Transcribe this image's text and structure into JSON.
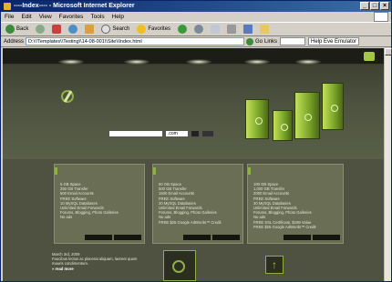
{
  "window": {
    "title": "----Index---- - Microsoft Internet Explorer",
    "minimize": "_",
    "maximize": "□",
    "close": "×"
  },
  "menu": [
    "File",
    "Edit",
    "View",
    "Favorites",
    "Tools",
    "Help"
  ],
  "toolbar": {
    "back": "Back",
    "search": "Search",
    "favorites": "Favorites"
  },
  "address": {
    "label": "Address",
    "value": "D:\\\\!Templates\\\\Testing\\\\14-08-001\\\\Site\\\\Index.html",
    "go": "Go",
    "links_label": "Links",
    "link1": "",
    "link2": "Help Eve Emulator"
  },
  "search": {
    "select_value": ".com"
  },
  "panels": [
    {
      "lines": [
        "5 GB Space",
        "250 GB Transfer",
        "500 Email Accounts",
        "FREE Software",
        "10 MySQL Databases",
        "Unlimited Email Forwards",
        "Forums, Blogging, Photo Galleries",
        "No ads"
      ]
    },
    {
      "lines": [
        "50 GB Space",
        "500 GB Transfer",
        "1500 Email Accounts",
        "FREE Software",
        "20 MySQL Databases",
        "Unlimited Email Forwards",
        "Forums, Blogging, Photo Galleries",
        "No ads",
        "FREE $25 Google AdWords™ Credit"
      ]
    },
    {
      "lines": [
        "100 GB Space",
        "1,000 GB Transfer",
        "2000 Email Accounts",
        "FREE Software",
        "30 MySQL Databases",
        "Unlimited Email Forwards",
        "Forums, Blogging, Photo Galleries",
        "No ads",
        "FREE SSL Certificate, $199 Value",
        "FREE $25 Google AdWords™ Credit"
      ]
    }
  ],
  "news": {
    "date": "March 3rd, 2009",
    "body": "Faucibus lectus ac placerat aliquam, laoreet quam mauris condimentum.",
    "more": "» read more"
  },
  "colors": {
    "accent": "#8fb043",
    "bg_dark": "#2a2c22",
    "panel": "#6a6e55"
  }
}
